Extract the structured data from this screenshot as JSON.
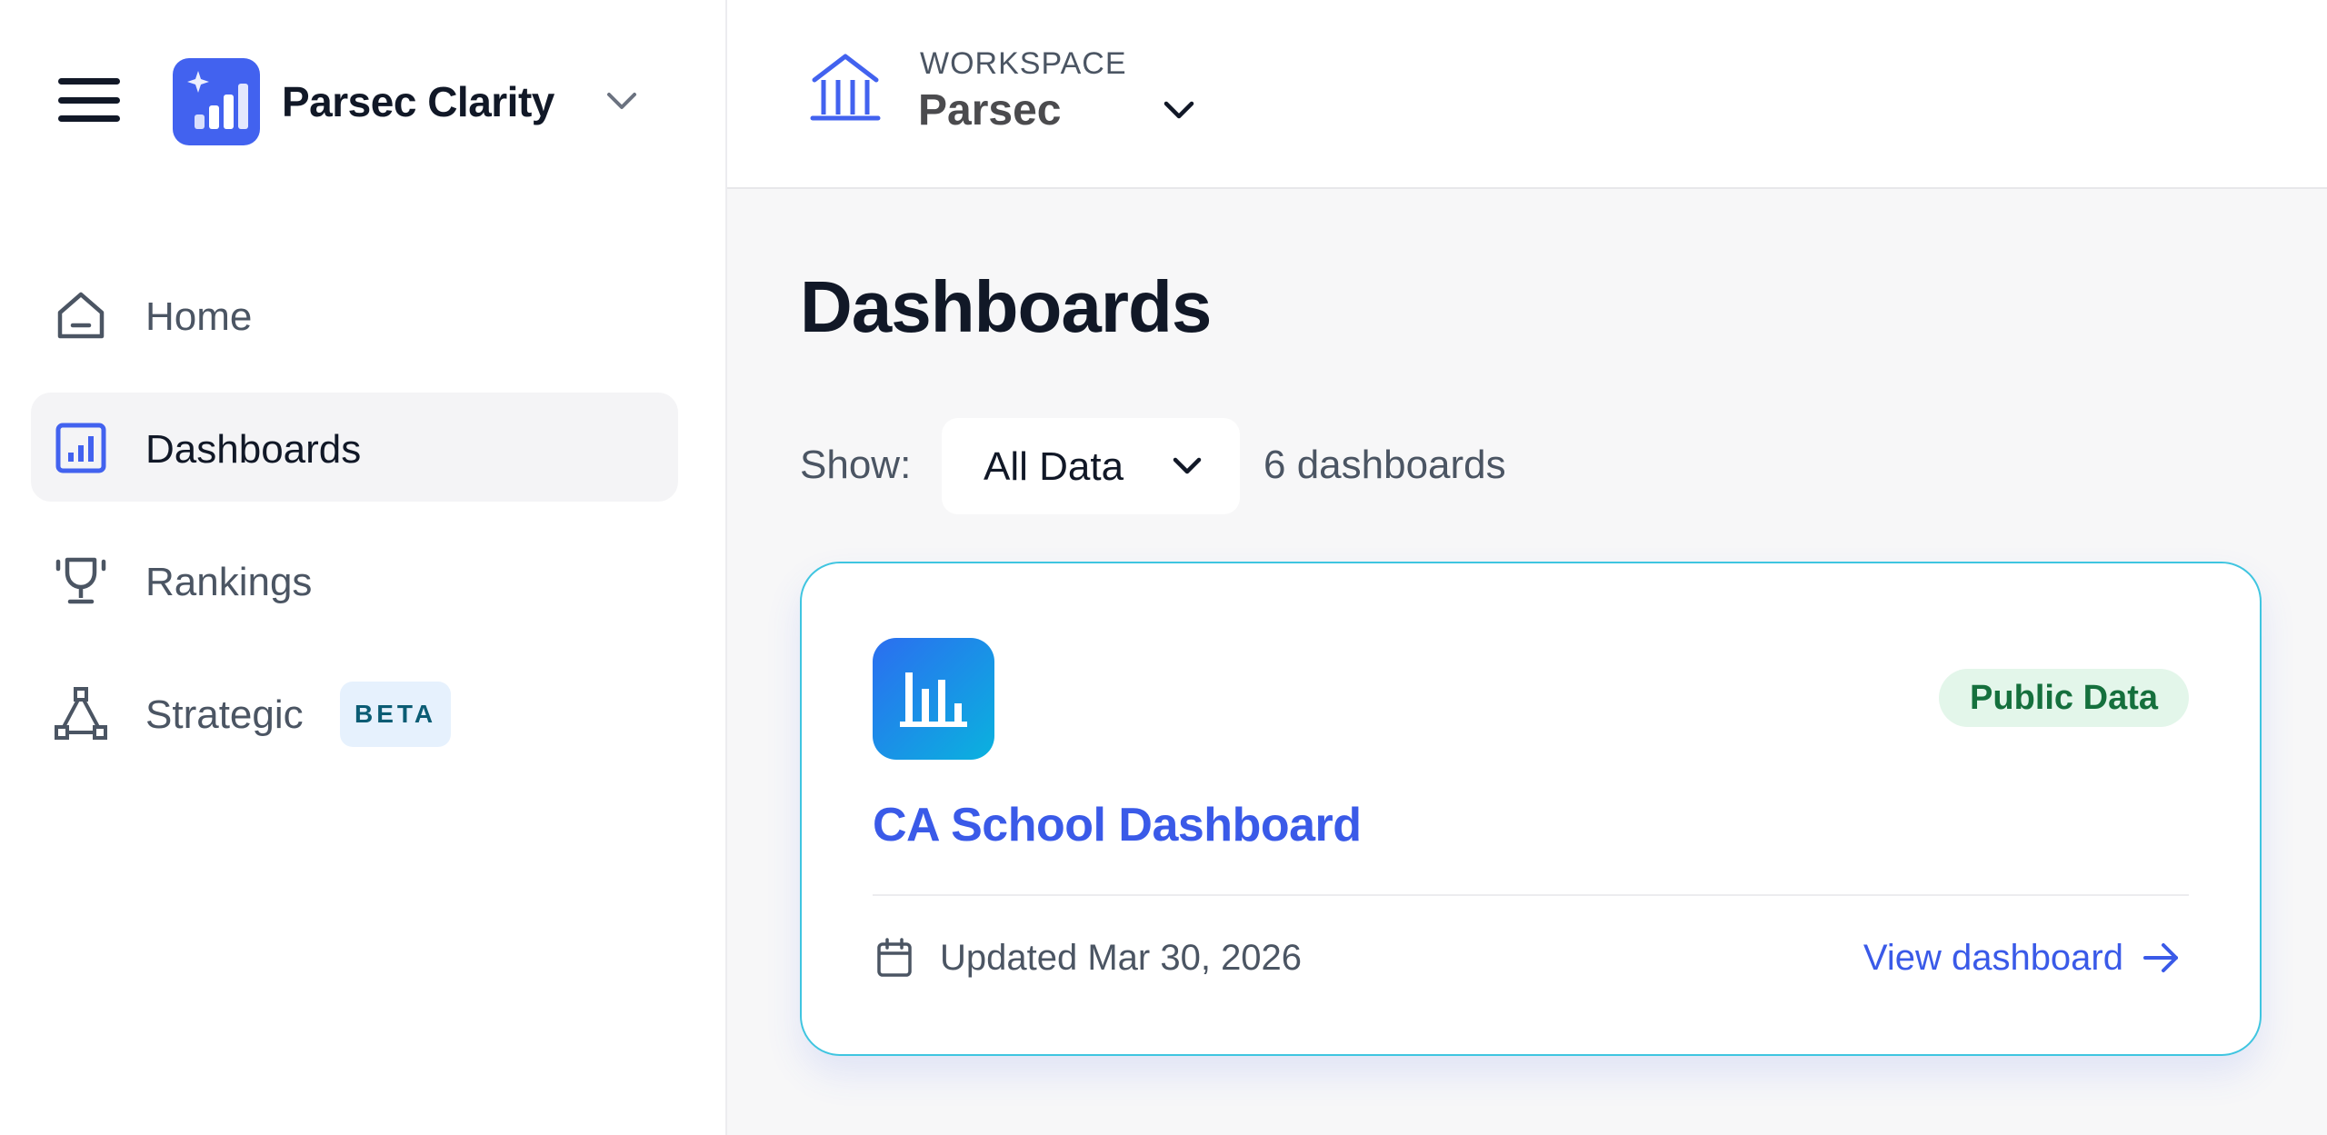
{
  "sidebar": {
    "brand": {
      "name": "Parsec Clarity"
    },
    "items": [
      {
        "label": "Home",
        "icon": "home-icon",
        "active": false
      },
      {
        "label": "Dashboards",
        "icon": "bar-chart-icon",
        "active": true
      },
      {
        "label": "Rankings",
        "icon": "trophy-icon",
        "active": false
      },
      {
        "label": "Strategic",
        "icon": "network-icon",
        "active": false,
        "badge": "BETA"
      }
    ]
  },
  "workspace": {
    "label": "WORKSPACE",
    "name": "Parsec",
    "icon": "building-icon"
  },
  "main": {
    "title": "Dashboards",
    "filter": {
      "label": "Show:",
      "selected": "All Data"
    },
    "count_label": "6 dashboards",
    "cards": [
      {
        "title": "CA School Dashboard",
        "badge": "Public Data",
        "updated": "Updated Mar 30, 2026",
        "link": "View dashboard"
      }
    ]
  },
  "colors": {
    "accent": "#4262ef",
    "link": "#3a5ae8",
    "card_border": "#3fc5e0",
    "badge_bg": "#e3f6ea",
    "badge_text": "#15703d",
    "beta_bg": "#e6f1fd",
    "beta_text": "#0b5c74"
  }
}
